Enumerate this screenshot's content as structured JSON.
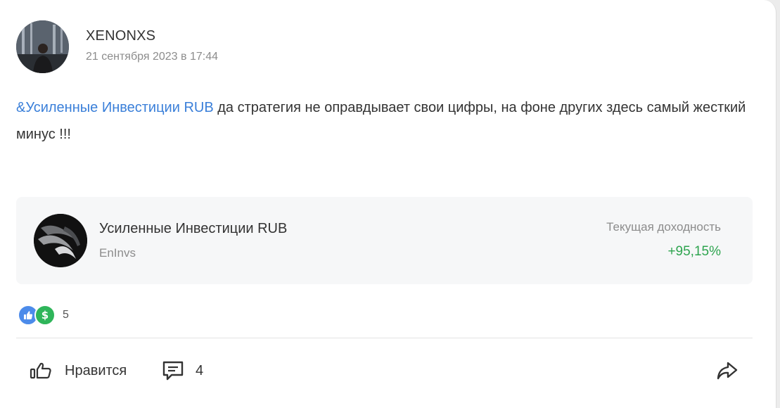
{
  "post": {
    "author": {
      "username": "XENONXS",
      "timestamp": "21 сентября 2023 в 17:44"
    },
    "text": {
      "mention": "&Усиленные Инвестиции RUB",
      "body": " да стратегия не оправдывает свои цифры, на фоне других здесь самый жесткий минус !!!"
    },
    "strategy_card": {
      "title": "Усиленные Инвестиции RUB",
      "author": "EnInvs",
      "yield_label": "Текущая доходность",
      "yield_value": "+95,15%",
      "yield_color": "#2ea44f"
    },
    "reactions": {
      "icons": [
        "thumbs-up-icon",
        "dollar-icon"
      ],
      "count": "5"
    },
    "actions": {
      "like_label": "Нравится",
      "comment_count": "4",
      "share_icon": "share-arrow-icon"
    }
  },
  "colors": {
    "mention": "#3a7fd9",
    "text": "#333333",
    "muted": "#8c8c8c",
    "positive": "#2ea44f",
    "card_bg": "#f6f7f8"
  }
}
